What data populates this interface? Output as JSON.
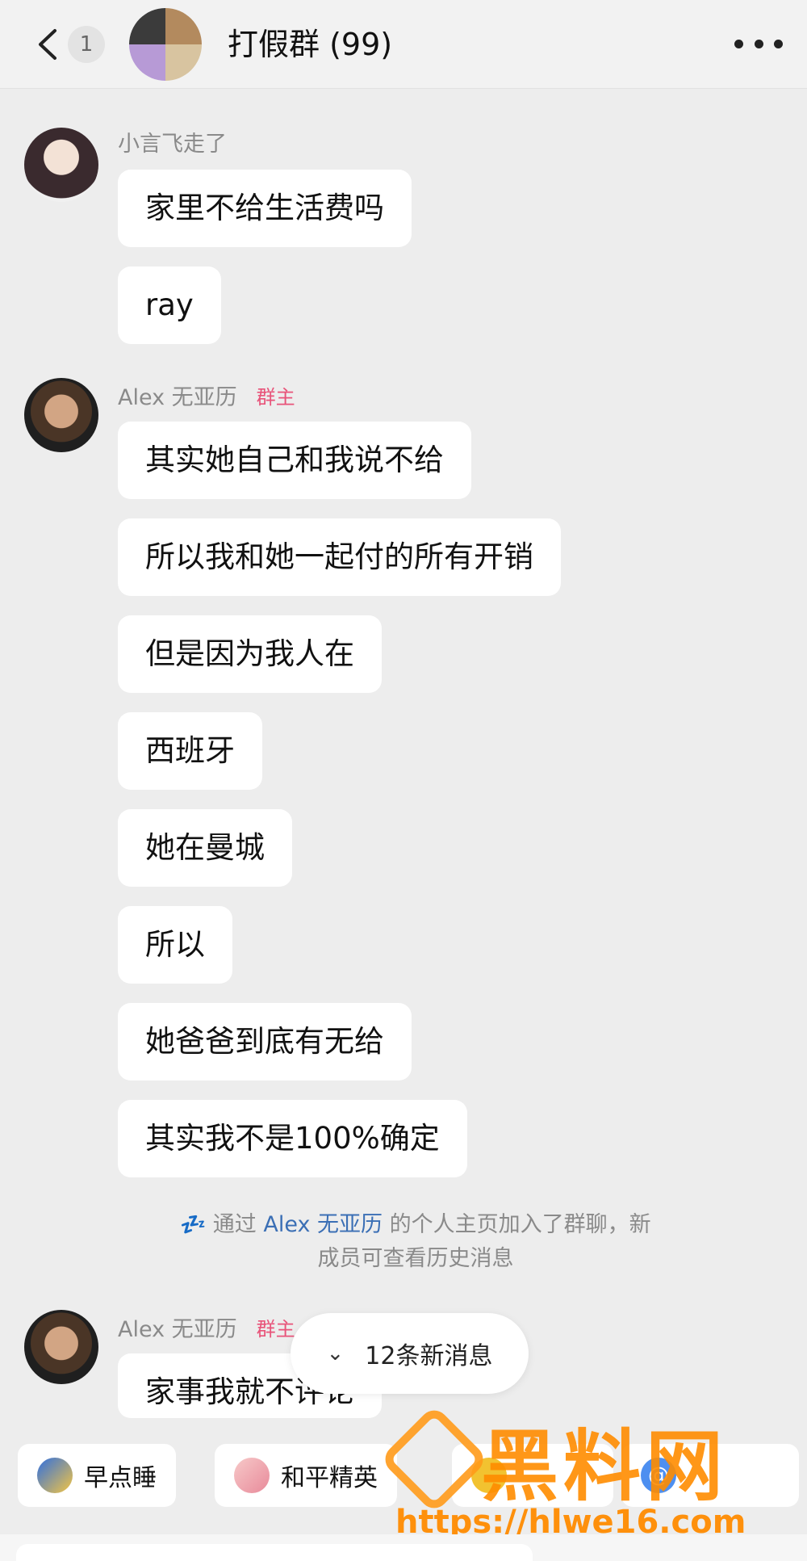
{
  "header": {
    "unread_count": "1",
    "title": "打假群 (99)"
  },
  "messages": [
    {
      "sender": "小言飞走了",
      "badge": "",
      "bubbles": [
        "家里不给生活费吗",
        "ray"
      ]
    },
    {
      "sender": "Alex 无亚历",
      "badge": "群主",
      "bubbles": [
        "其实她自己和我说不给",
        "所以我和她一起付的所有开销",
        "但是因为我人在",
        "西班牙",
        "她在曼城",
        "所以",
        "她爸爸到底有无给",
        "其实我不是100%确定"
      ]
    },
    {
      "sender": "Alex 无亚历",
      "badge": "群主",
      "bubbles": [
        "家事我就不评论"
      ]
    }
  ],
  "system_message": {
    "prefix": "通过",
    "link_name": "Alex 无亚历",
    "suffix_line1": "的个人主页加入了群聊，新",
    "line2": "成员可查看历史消息"
  },
  "new_messages_pill": "12条新消息",
  "quick_chips": [
    "早点睡",
    "和平精英"
  ],
  "watermark": {
    "logo_text": "黑料网",
    "url": "https://hlwe16.com"
  },
  "icons": {
    "back": "chevron-left-icon",
    "more": "more-horizontal-icon",
    "new_messages": "double-chevron-down-icon"
  },
  "colors": {
    "background": "#ededed",
    "bubble": "#ffffff",
    "owner_badge": "#e8547a",
    "link": "#3b6fb5",
    "watermark": "#ff8c00"
  }
}
